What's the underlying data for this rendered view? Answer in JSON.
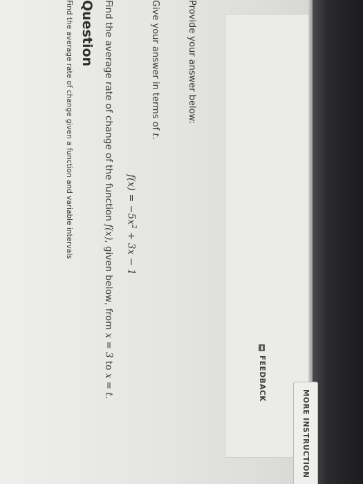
{
  "breadcrumb": "Find the average rate of change given a function and variable intervals",
  "section_heading": "Question",
  "question": {
    "prefix": "Find the average rate of change of the function ",
    "func": "f(x)",
    "middle": ", given below, from ",
    "from": "x = 3",
    "to_word": " to ",
    "to": "x = t",
    "suffix": "."
  },
  "formula": {
    "lhs": "f(x) = −5x",
    "exp": "2",
    "rhs": " + 3x − 1"
  },
  "instruction": {
    "prefix": "Give your answer in terms of ",
    "var": "t",
    "suffix": "."
  },
  "provide_label": "Provide your answer below:",
  "answer_value": "",
  "buttons": {
    "feedback": "FEEDBACK",
    "more_instructions": "MORE INSTRUCTION"
  },
  "icons": {
    "feedback": "feedback-icon"
  }
}
